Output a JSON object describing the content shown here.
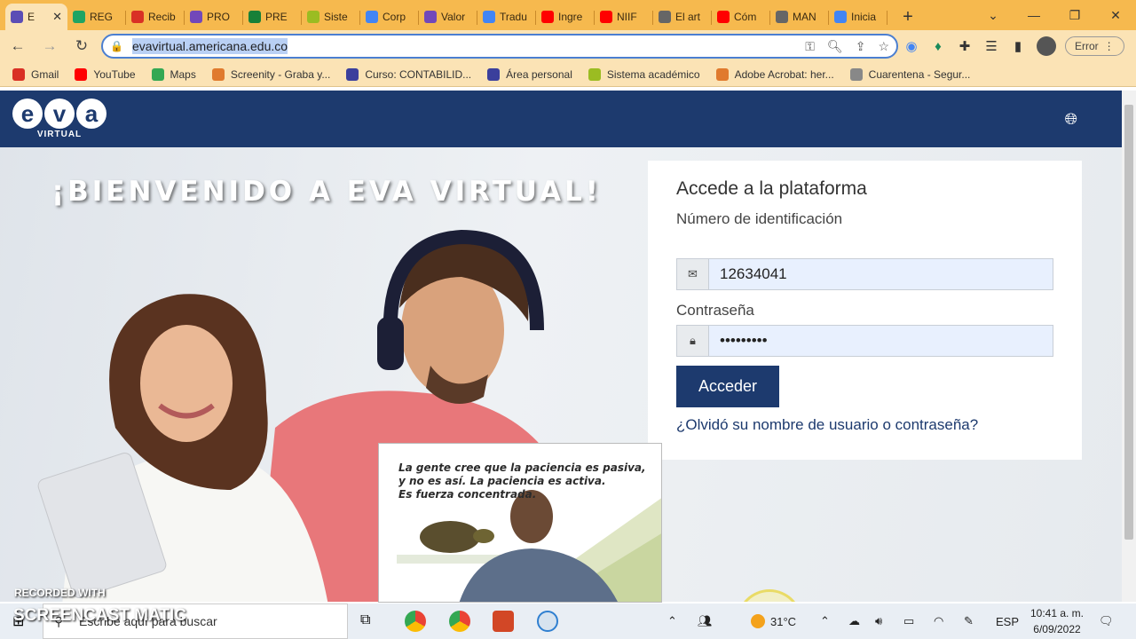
{
  "browser": {
    "tabs": [
      {
        "label": "E",
        "icon": "eva-icon",
        "color": "#5b4db5",
        "active": true
      },
      {
        "label": "REG",
        "icon": "drive-icon",
        "color": "#1fa463"
      },
      {
        "label": "Recib",
        "icon": "gmail-icon",
        "color": "#d93025"
      },
      {
        "label": "PRO",
        "icon": "forms-icon",
        "color": "#7248b9"
      },
      {
        "label": "PRE",
        "icon": "sheets-icon",
        "color": "#188038"
      },
      {
        "label": "Siste",
        "icon": "moodle-icon",
        "color": "#9bbc22"
      },
      {
        "label": "Corp",
        "icon": "calendar-icon",
        "color": "#4285f4"
      },
      {
        "label": "Valor",
        "icon": "forms-icon",
        "color": "#7248b9"
      },
      {
        "label": "Tradu",
        "icon": "translate-icon",
        "color": "#4285f4"
      },
      {
        "label": "Ingre",
        "icon": "youtube-icon",
        "color": "#ff0000"
      },
      {
        "label": "NIIF",
        "icon": "youtube-icon",
        "color": "#ff0000"
      },
      {
        "label": "El art",
        "icon": "globe-icon",
        "color": "#666666"
      },
      {
        "label": "Cóm",
        "icon": "youtube-icon",
        "color": "#ff0000"
      },
      {
        "label": "MAN",
        "icon": "globe-icon",
        "color": "#666666"
      },
      {
        "label": "Inicia",
        "icon": "google-icon",
        "color": "#4285f4"
      }
    ],
    "url": "evavirtual.americana.edu.co",
    "error_label": "Error",
    "bookmarks": [
      {
        "label": "Gmail",
        "icon": "gmail-icon",
        "color": "#d93025"
      },
      {
        "label": "YouTube",
        "icon": "youtube-icon",
        "color": "#ff0000"
      },
      {
        "label": "Maps",
        "icon": "maps-icon",
        "color": "#34a853"
      },
      {
        "label": "Screenity - Graba y...",
        "icon": "screenity-icon",
        "color": "#e07a2e"
      },
      {
        "label": "Curso: CONTABILID...",
        "icon": "eva-icon",
        "color": "#3b3f9c"
      },
      {
        "label": "Área personal",
        "icon": "eva-icon",
        "color": "#3b3f9c"
      },
      {
        "label": "Sistema académico",
        "icon": "moodle-icon",
        "color": "#9bbc22"
      },
      {
        "label": "Adobe Acrobat: her...",
        "icon": "screenity-icon",
        "color": "#e07a2e"
      },
      {
        "label": "Cuarentena - Segur...",
        "icon": "lock-icon",
        "color": "#888888"
      }
    ]
  },
  "site": {
    "logo_letters": [
      "e",
      "v",
      "a"
    ],
    "logo_sub": "VIRTUAL",
    "welcome": "¡BIENVENIDO A EVA VIRTUAL!",
    "brand_color": "#1d3a6e"
  },
  "login": {
    "title": "Accede a la plataforma",
    "id_label": "Número de identificación",
    "id_value": "12634041",
    "password_label": "Contraseña",
    "password_value": "•••••••••",
    "submit_label": "Acceder",
    "forgot_link": "¿Olvidó su nombre de usuario o contraseña?"
  },
  "webcam": {
    "quote_lines": [
      "La gente cree que la paciencia es pasiva,",
      "y no es así. La paciencia es activa.",
      "Es fuerza concentrada."
    ]
  },
  "watermark": {
    "recorded_with": "RECORDED WITH",
    "brand": "SCREENCAST MATIC"
  },
  "taskbar": {
    "search_placeholder": "Escribe aquí para buscar",
    "temperature": "31°C",
    "language": "ESP",
    "time": "10:41 a. m.",
    "date": "6/09/2022"
  }
}
